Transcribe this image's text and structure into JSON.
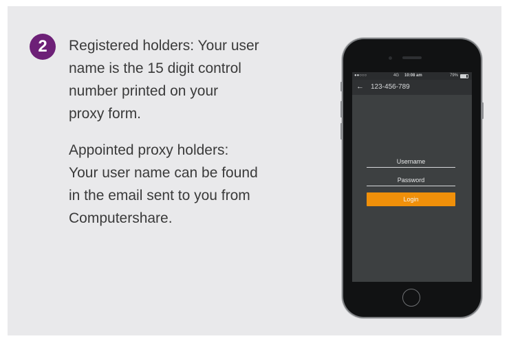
{
  "step": {
    "number": "2"
  },
  "text": {
    "registered": "Registered holders: Your user\nname is the 15 digit control\nnumber printed on your\nproxy form.",
    "appointed": "Appointed proxy holders:\nYour user name can be found\nin the email sent to you from\nComputershare."
  },
  "phone": {
    "status": {
      "signal": "●●○○○",
      "network": "4G",
      "time": "10:08 am",
      "battery": "79%"
    },
    "nav": {
      "back_icon": "arrow-left-icon",
      "title": "123-456-789"
    },
    "form": {
      "username_placeholder": "Username",
      "password_placeholder": "Password",
      "login_label": "Login"
    }
  },
  "colors": {
    "badge": "#6d2077",
    "panel_bg": "#e9e9eb",
    "login_button": "#f0900a",
    "screen_bg": "#3d4041"
  }
}
